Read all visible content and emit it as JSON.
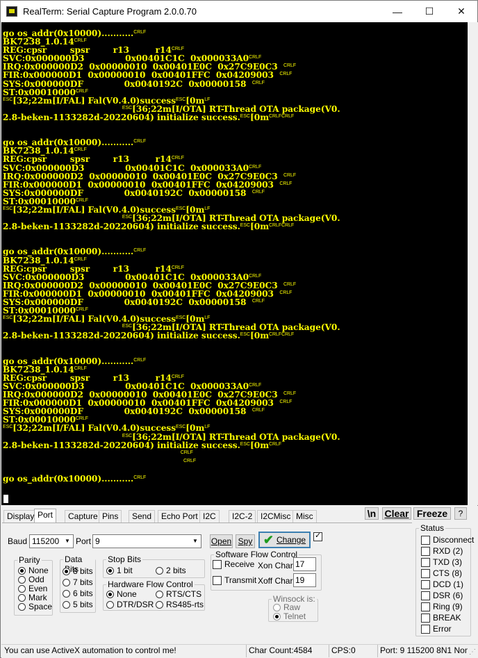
{
  "window": {
    "title": "RealTerm: Serial Capture Program 2.0.0.70",
    "minimize": "—",
    "maximize": "☐",
    "close": "✕"
  },
  "terminal": {
    "lines": [
      [
        [
          "t",
          "go os_addr(0x10000)..........."
        ],
        [
          "c",
          "CRLF"
        ]
      ],
      [
        [
          "t",
          "BK7238_1.0.14"
        ],
        [
          "c",
          "CRLF"
        ]
      ],
      [
        [
          "t",
          "REG:cpsr        spsr        r13         r14"
        ],
        [
          "c",
          "CRLF"
        ]
      ],
      [
        [
          "t",
          "SVC:0x000000D3              0x00401C1C  0x000033A0"
        ],
        [
          "c",
          "CRLF"
        ]
      ],
      [
        [
          "t",
          "IRQ:0x000000D2  0x00000010  0x00401E0C  0x27C9E0C3  "
        ],
        [
          "c",
          "CRLF"
        ]
      ],
      [
        [
          "t",
          "FIR:0x000000D1  0x00000010  0x00401FFC  0x04209003  "
        ],
        [
          "c",
          "CRLF"
        ]
      ],
      [
        [
          "t",
          "SYS:0x000000DF              0x0040192C  0x00000158  "
        ],
        [
          "c",
          "CRLF"
        ]
      ],
      [
        [
          "t",
          "ST:0x00010000"
        ],
        [
          "c",
          "CRLF"
        ]
      ],
      [
        [
          "c",
          "ESC"
        ],
        [
          "t",
          "[32;22m[I/FAL] Fal(V0.4.0)success"
        ],
        [
          "c",
          "ESC"
        ],
        [
          "t",
          "[0m"
        ],
        [
          "c",
          "LF"
        ]
      ],
      [
        [
          "t",
          "                                         "
        ],
        [
          "c",
          "ESC"
        ],
        [
          "t",
          "[36;22m[I/OTA] RT-Thread OTA package(V0."
        ]
      ],
      [
        [
          "t",
          "2.8-beken-1133282d-20220604) initialize success."
        ],
        [
          "c",
          "ESC"
        ],
        [
          "t",
          "[0m"
        ],
        [
          "c",
          "CRLFCRLF"
        ]
      ],
      [
        [
          "t",
          ""
        ]
      ],
      [
        [
          "t",
          ""
        ]
      ],
      [
        [
          "t",
          "go os_addr(0x10000)..........."
        ],
        [
          "c",
          "CRLF"
        ]
      ],
      [
        [
          "t",
          "BK7238_1.0.14"
        ],
        [
          "c",
          "CRLF"
        ]
      ],
      [
        [
          "t",
          "REG:cpsr        spsr        r13         r14"
        ],
        [
          "c",
          "CRLF"
        ]
      ],
      [
        [
          "t",
          "SVC:0x000000D3              0x00401C1C  0x000033A0"
        ],
        [
          "c",
          "CRLF"
        ]
      ],
      [
        [
          "t",
          "IRQ:0x000000D2  0x00000010  0x00401E0C  0x27C9E0C3  "
        ],
        [
          "c",
          "CRLF"
        ]
      ],
      [
        [
          "t",
          "FIR:0x000000D1  0x00000010  0x00401FFC  0x04209003  "
        ],
        [
          "c",
          "CRLF"
        ]
      ],
      [
        [
          "t",
          "SYS:0x000000DF              0x0040192C  0x00000158  "
        ],
        [
          "c",
          "CRLF"
        ]
      ],
      [
        [
          "t",
          "ST:0x00010000"
        ],
        [
          "c",
          "CRLF"
        ]
      ],
      [
        [
          "c",
          "ESC"
        ],
        [
          "t",
          "[32;22m[I/FAL] Fal(V0.4.0)success"
        ],
        [
          "c",
          "ESC"
        ],
        [
          "t",
          "[0m"
        ],
        [
          "c",
          "LF"
        ]
      ],
      [
        [
          "t",
          "                                         "
        ],
        [
          "c",
          "ESC"
        ],
        [
          "t",
          "[36;22m[I/OTA] RT-Thread OTA package(V0."
        ]
      ],
      [
        [
          "t",
          "2.8-beken-1133282d-20220604) initialize success."
        ],
        [
          "c",
          "ESC"
        ],
        [
          "t",
          "[0m"
        ],
        [
          "c",
          "CRLFCRLF"
        ]
      ],
      [
        [
          "t",
          ""
        ]
      ],
      [
        [
          "t",
          ""
        ]
      ],
      [
        [
          "t",
          "go os_addr(0x10000)..........."
        ],
        [
          "c",
          "CRLF"
        ]
      ],
      [
        [
          "t",
          "BK7238_1.0.14"
        ],
        [
          "c",
          "CRLF"
        ]
      ],
      [
        [
          "t",
          "REG:cpsr        spsr        r13         r14"
        ],
        [
          "c",
          "CRLF"
        ]
      ],
      [
        [
          "t",
          "SVC:0x000000D3              0x00401C1C  0x000033A0"
        ],
        [
          "c",
          "CRLF"
        ]
      ],
      [
        [
          "t",
          "IRQ:0x000000D2  0x00000010  0x00401E0C  0x27C9E0C3  "
        ],
        [
          "c",
          "CRLF"
        ]
      ],
      [
        [
          "t",
          "FIR:0x000000D1  0x00000010  0x00401FFC  0x04209003  "
        ],
        [
          "c",
          "CRLF"
        ]
      ],
      [
        [
          "t",
          "SYS:0x000000DF              0x0040192C  0x00000158  "
        ],
        [
          "c",
          "CRLF"
        ]
      ],
      [
        [
          "t",
          "ST:0x00010000"
        ],
        [
          "c",
          "CRLF"
        ]
      ],
      [
        [
          "c",
          "ESC"
        ],
        [
          "t",
          "[32;22m[I/FAL] Fal(V0.4.0)success"
        ],
        [
          "c",
          "ESC"
        ],
        [
          "t",
          "[0m"
        ],
        [
          "c",
          "LF"
        ]
      ],
      [
        [
          "t",
          "                                         "
        ],
        [
          "c",
          "ESC"
        ],
        [
          "t",
          "[36;22m[I/OTA] RT-Thread OTA package(V0."
        ]
      ],
      [
        [
          "t",
          "2.8-beken-1133282d-20220604) initialize success."
        ],
        [
          "c",
          "ESC"
        ],
        [
          "t",
          "[0m"
        ],
        [
          "c",
          "CRLFCRLF"
        ]
      ],
      [
        [
          "t",
          ""
        ]
      ],
      [
        [
          "t",
          ""
        ]
      ],
      [
        [
          "t",
          "go os_addr(0x10000)..........."
        ],
        [
          "c",
          "CRLF"
        ]
      ],
      [
        [
          "t",
          "BK7238_1.0.14"
        ],
        [
          "c",
          "CRLF"
        ]
      ],
      [
        [
          "t",
          "REG:cpsr        spsr        r13         r14"
        ],
        [
          "c",
          "CRLF"
        ]
      ],
      [
        [
          "t",
          "SVC:0x000000D3              0x00401C1C  0x000033A0"
        ],
        [
          "c",
          "CRLF"
        ]
      ],
      [
        [
          "t",
          "IRQ:0x000000D2  0x00000010  0x00401E0C  0x27C9E0C3  "
        ],
        [
          "c",
          "CRLF"
        ]
      ],
      [
        [
          "t",
          "FIR:0x000000D1  0x00000010  0x00401FFC  0x04209003  "
        ],
        [
          "c",
          "CRLF"
        ]
      ],
      [
        [
          "t",
          "SYS:0x000000DF              0x0040192C  0x00000158  "
        ],
        [
          "c",
          "CRLF"
        ]
      ],
      [
        [
          "t",
          "ST:0x00010000"
        ],
        [
          "c",
          "CRLF"
        ]
      ],
      [
        [
          "c",
          "ESC"
        ],
        [
          "t",
          "[32;22m[I/FAL] Fal(V0.4.0)success"
        ],
        [
          "c",
          "ESC"
        ],
        [
          "t",
          "[0m"
        ],
        [
          "c",
          "LF"
        ]
      ],
      [
        [
          "t",
          "                                         "
        ],
        [
          "c",
          "ESC"
        ],
        [
          "t",
          "[36;22m[I/OTA] RT-Thread OTA package(V0."
        ]
      ],
      [
        [
          "t",
          "2.8-beken-1133282d-20220604) initialize success."
        ],
        [
          "c",
          "ESC"
        ],
        [
          "t",
          "[0m"
        ],
        [
          "c",
          "CRLF"
        ]
      ],
      [
        [
          "t",
          "                                                             "
        ],
        [
          "c",
          "CRLF"
        ]
      ],
      [
        [
          "t",
          "                                                              "
        ],
        [
          "c",
          "CRLF"
        ]
      ],
      [
        [
          "t",
          ""
        ]
      ],
      [
        [
          "t",
          "go os_addr(0x10000)..........."
        ],
        [
          "c",
          "CRLF"
        ]
      ]
    ]
  },
  "tabs": [
    "Display",
    "Port",
    "Capture",
    "Pins",
    "Send",
    "Echo Port",
    "I2C",
    "I2C-2",
    "I2CMisc",
    "Misc"
  ],
  "top_buttons": {
    "newline": "\\n",
    "clear": "Clear",
    "freeze": "Freeze",
    "help": "?"
  },
  "port": {
    "baud_label": "Baud",
    "baud_value": "115200",
    "port_label": "Port",
    "port_value": "9",
    "open": "Open",
    "spy": "Spy",
    "change": "Change"
  },
  "parity": {
    "title": "Parity",
    "options": [
      "None",
      "Odd",
      "Even",
      "Mark",
      "Space"
    ],
    "selected": "None"
  },
  "databits": {
    "title": "Data Bits",
    "options": [
      "8 bits",
      "7 bits",
      "6 bits",
      "5 bits"
    ],
    "selected": "8 bits"
  },
  "stopbits": {
    "title": "Stop Bits",
    "options": [
      "1 bit",
      "2 bits"
    ],
    "selected": "1 bit"
  },
  "hwflow": {
    "title": "Hardware Flow Control",
    "options": [
      "None",
      "RTS/CTS",
      "DTR/DSR",
      "RS485-rts"
    ],
    "selected": "None"
  },
  "swflow": {
    "title": "Software Flow Control",
    "receive": "Receive",
    "transmit": "Transmit",
    "xon_label": "Xon Char:",
    "xon_value": "17",
    "xoff_label": "Xoff Char:",
    "xoff_value": "19"
  },
  "winsock": {
    "title": "Winsock is:",
    "options": [
      "Raw",
      "Telnet"
    ],
    "selected": "Telnet"
  },
  "status": {
    "title": "Status",
    "items": [
      "Disconnect",
      "RXD (2)",
      "TXD (3)",
      "CTS (8)",
      "DCD (1)",
      "DSR (6)",
      "Ring (9)",
      "BREAK",
      "Error"
    ]
  },
  "statusbar": {
    "message": "You can use ActiveX automation to control me!",
    "char_count": "Char Count:4584",
    "cps": "CPS:0",
    "port_info": "Port: 9 115200 8N1 Non"
  }
}
